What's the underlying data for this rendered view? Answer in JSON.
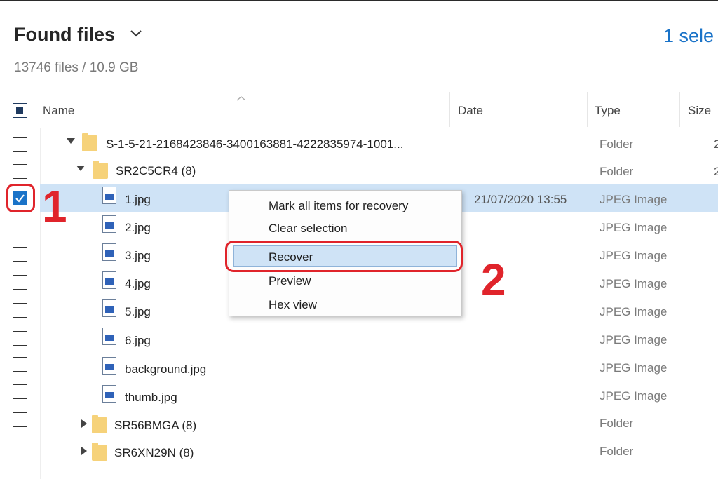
{
  "header": {
    "title": "Found files",
    "subtitle": "13746 files / 10.9 GB",
    "selection_text": "1 sele"
  },
  "columns": {
    "name": "Name",
    "date": "Date",
    "type": "Type",
    "size": "Size"
  },
  "rows": [
    {
      "name": "S-1-5-21-2168423846-3400163881-4222835974-1001...",
      "date": "",
      "type": "Folder",
      "size": "2",
      "kind": "folder",
      "expanded": true,
      "checked": false
    },
    {
      "name": "SR2C5CR4 (8)",
      "date": "",
      "type": "Folder",
      "size": "2",
      "kind": "folder",
      "expanded": true,
      "checked": false
    },
    {
      "name": "1.jpg",
      "date": "21/07/2020 13:55",
      "type": "JPEG Image",
      "size": "",
      "kind": "file",
      "checked": true
    },
    {
      "name": "2.jpg",
      "date": "",
      "type": "JPEG Image",
      "size": "",
      "kind": "file",
      "checked": false
    },
    {
      "name": "3.jpg",
      "date": "",
      "type": "JPEG Image",
      "size": "",
      "kind": "file",
      "checked": false
    },
    {
      "name": "4.jpg",
      "date": "",
      "type": "JPEG Image",
      "size": "",
      "kind": "file",
      "checked": false
    },
    {
      "name": "5.jpg",
      "date": "",
      "type": "JPEG Image",
      "size": "",
      "kind": "file",
      "checked": false
    },
    {
      "name": "6.jpg",
      "date": "",
      "type": "JPEG Image",
      "size": "",
      "kind": "file",
      "checked": false
    },
    {
      "name": "background.jpg",
      "date": "",
      "type": "JPEG Image",
      "size": "",
      "kind": "file",
      "checked": false
    },
    {
      "name": "thumb.jpg",
      "date": "",
      "type": "JPEG Image",
      "size": "",
      "kind": "file",
      "checked": false
    },
    {
      "name": "SR56BMGA (8)",
      "date": "",
      "type": "Folder",
      "size": "",
      "kind": "folder",
      "expanded": false,
      "checked": false
    },
    {
      "name": "SR6XN29N (8)",
      "date": "",
      "type": "Folder",
      "size": "",
      "kind": "folder",
      "expanded": false,
      "checked": false
    }
  ],
  "context_menu": {
    "items": [
      "Mark all items for recovery",
      "Clear selection",
      "Recover",
      "Preview",
      "Hex view"
    ],
    "highlighted": "Recover"
  },
  "annotations": {
    "step1": "1",
    "step2": "2"
  },
  "colors": {
    "accent": "#1a73c8",
    "annotation_red": "#e0242b",
    "selection_bg": "#cfe3f6"
  }
}
